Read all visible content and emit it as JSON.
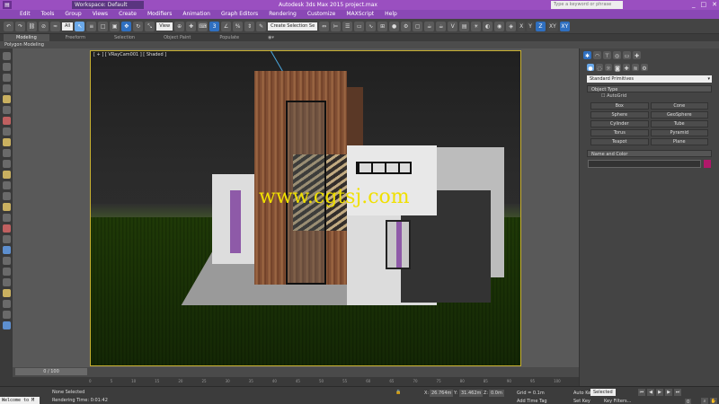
{
  "titlebar": {
    "app_icon": "3ds-max-logo-icon",
    "workspace_label": "Workspace: Default",
    "title": "Autodesk 3ds Max 2015    project.max",
    "search_placeholder": "Type a keyword or phrase",
    "minimize": "_",
    "maximize": "□",
    "close": "✕"
  },
  "menus": [
    "Edit",
    "Tools",
    "Group",
    "Views",
    "Create",
    "Modifiers",
    "Animation",
    "Graph Editors",
    "Rendering",
    "Customize",
    "MAXScript",
    "Help"
  ],
  "toolbar": {
    "filter_value": "All",
    "view_value": "View",
    "selection_set_placeholder": "Create Selection Se",
    "axis_x": "X",
    "axis_y": "Y",
    "axis_z": "Z",
    "axis_xy": "XY",
    "axis_xz": "XY"
  },
  "ribbon": {
    "tabs": [
      "Modeling",
      "Freeform",
      "Selection",
      "Object Paint",
      "Populate"
    ],
    "active_tab": "Modeling",
    "sub_label": "Polygon Modeling"
  },
  "viewport": {
    "label": "[ + ] [ VRayCam001 ] [ Shaded ]",
    "watermark": "www.cgtsj.com"
  },
  "command_panel": {
    "category_dropdown": "Standard Primitives",
    "object_type_header": "Object Type",
    "autogrid_label": "AutoGrid",
    "primitives": [
      "Box",
      "Cone",
      "Sphere",
      "GeoSphere",
      "Cylinder",
      "Tube",
      "Torus",
      "Pyramid",
      "Teapot",
      "Plane"
    ],
    "name_color_header": "Name and Color",
    "object_color": "#b0186a"
  },
  "timeline": {
    "frame_readout": "0 / 100",
    "ticks": [
      "0",
      "5",
      "10",
      "15",
      "20",
      "25",
      "30",
      "35",
      "40",
      "45",
      "50",
      "55",
      "60",
      "65",
      "70",
      "75",
      "80",
      "85",
      "90",
      "95",
      "100"
    ]
  },
  "statusbar": {
    "listener": "Welcome to M",
    "selection_status": "None Selected",
    "render_time": "Rendering Time: 0:01:42",
    "x_label": "X:",
    "x_value": "26.764m",
    "y_label": "Y:",
    "y_value": "31.462m",
    "z_label": "Z:",
    "z_value": "0.0m",
    "grid": "Grid = 0.1m",
    "add_time_tag": "Add Time Tag",
    "auto_key": "Auto Key",
    "set_key": "Set Key",
    "key_mode_value": "Selected",
    "key_filters": "Key Filters...",
    "frame_value": "0"
  },
  "colors": {
    "titlebar": "#9a4fc0",
    "menubar": "#8a48b5",
    "viewport_border": "#c8b030",
    "watermark": "#f0e000"
  }
}
